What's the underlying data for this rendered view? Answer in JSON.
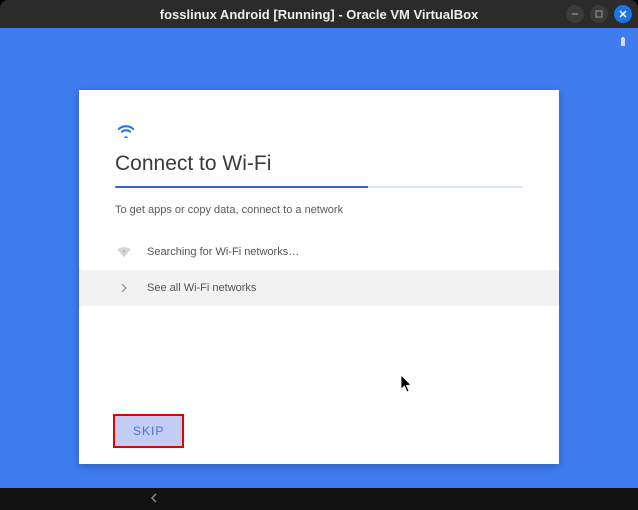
{
  "window": {
    "title": "fosslinux Android [Running] - Oracle VM VirtualBox"
  },
  "screen": {
    "heading": "Connect to Wi-Fi",
    "subtext": "To get apps or copy data, connect to a network",
    "progress_percent": 62,
    "searching_label": "Searching for Wi-Fi networks…",
    "see_all_label": "See all Wi-Fi networks",
    "skip_label": "SKIP"
  }
}
